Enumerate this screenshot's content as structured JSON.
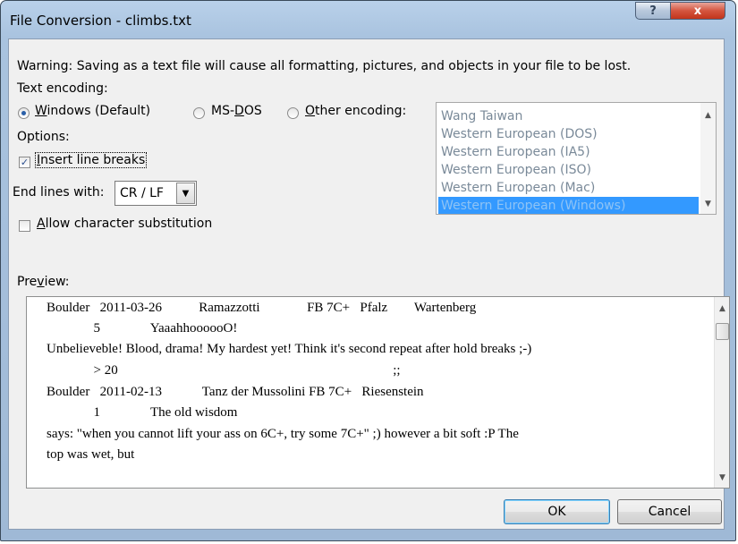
{
  "window": {
    "title": "File Conversion - climbs.txt",
    "help_label": "?",
    "close_label": "x"
  },
  "warning": "Warning: Saving as a text file will cause all formatting, pictures, and objects in your file to be lost.",
  "encoding": {
    "heading": "Text encoding:",
    "options": [
      {
        "pre": "",
        "key": "W",
        "post": "indows (Default)",
        "checked": true
      },
      {
        "pre": "MS-",
        "key": "D",
        "post": "OS",
        "checked": false
      },
      {
        "pre": "",
        "key": "O",
        "post": "ther encoding:",
        "checked": false
      }
    ],
    "list": [
      "Wang Taiwan",
      "Western European (DOS)",
      "Western European (IA5)",
      "Western European (ISO)",
      "Western European (Mac)",
      "Western European (Windows)"
    ],
    "selected_index": 5
  },
  "options": {
    "heading": "Options:",
    "insert_line_breaks": {
      "pre": "",
      "key": "I",
      "post": "nsert line breaks",
      "checked": true
    },
    "end_lines_label": "End lines with:",
    "end_lines_value": "CR / LF",
    "allow_substitution": {
      "pre": "",
      "key": "A",
      "post": "llow character substitution",
      "checked": false
    }
  },
  "preview": {
    "label_pre": "Pre",
    "label_key": "v",
    "label_post": "iew:",
    "lines": [
      "Boulder   2011-03-26           Ramazzotti              FB 7C+   Pfalz        Wartenberg",
      "              5               YaaahhoooooO!",
      "Unbelieveble! Blood, drama! My hardest yet! Think it's second repeat after hold breaks ;-)",
      "              > 20                                                                                  ;;",
      "Boulder   2011-02-13            Tanz der Mussolini FB 7C+   Riesenstein",
      "              1               The old wisdom",
      "says: \"when you cannot lift your ass on 6C+, try some 7C+\" ;) however a bit soft :P The",
      "top was wet, but"
    ]
  },
  "buttons": {
    "ok": "OK",
    "cancel": "Cancel"
  }
}
